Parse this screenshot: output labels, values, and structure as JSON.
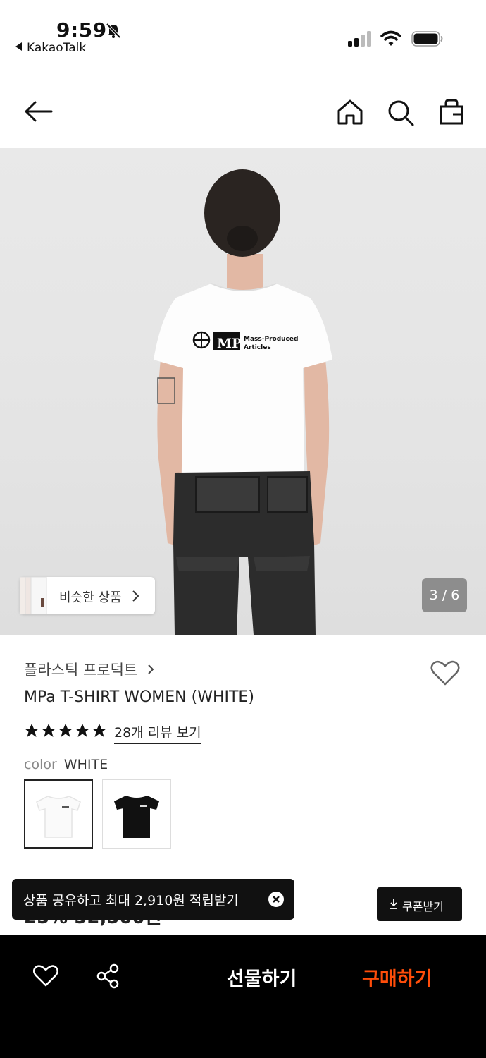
{
  "status_bar": {
    "time": "9:59",
    "back_app": "KakaoTalk"
  },
  "nav": {
    "icons": [
      "back-arrow-icon",
      "home-icon",
      "search-icon",
      "shopping-bag-icon"
    ]
  },
  "gallery": {
    "similar_label": "비슷한 상품",
    "pager": "3 / 6",
    "shirt_logo_text": "MPa",
    "shirt_tagline_1": "Mass-Produced",
    "shirt_tagline_2": "Articles"
  },
  "product": {
    "brand": "플라스틱 프로덕트",
    "title": "MPa T-SHIRT WOMEN (WHITE)",
    "rating": 5,
    "review_link": "28개 리뷰 보기",
    "color_label": "color",
    "color_value": "WHITE",
    "swatches": [
      "WHITE",
      "BLACK"
    ],
    "price_partial": "25% 52,500원"
  },
  "toast": {
    "text": "상품 공유하고 최대 2,910원 적립받기"
  },
  "coupon": {
    "label": "쿠폰받기"
  },
  "bottom_bar": {
    "gift_label": "선물하기",
    "buy_label": "구매하기",
    "accent": "#ff4d0a"
  }
}
